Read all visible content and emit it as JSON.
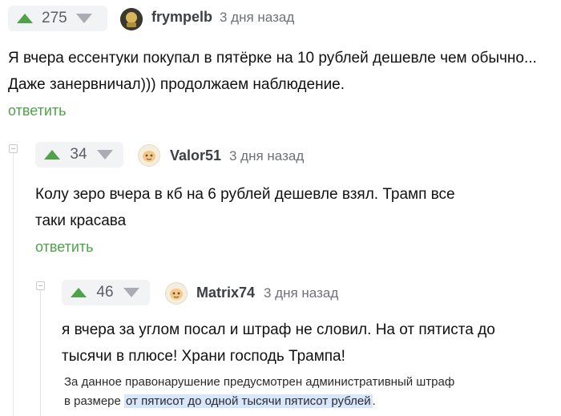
{
  "comments": [
    {
      "votes": "275",
      "user": "frympelb",
      "time": "3 дня назад",
      "lines": [
        "Я вчера ессентуки покупал в пятёрке на 10 рублей дешевле чем обычно...",
        "Даже занервничал))) продолжаем наблюдение."
      ],
      "reply": "ответить"
    },
    {
      "votes": "34",
      "user": "Valor51",
      "time": "3 дня назад",
      "lines": [
        "Колу зеро вчера в кб на 6 рублей дешевле взял. Трамп все",
        "таки красава"
      ],
      "reply": "ответить"
    },
    {
      "votes": "46",
      "user": "Matrix74",
      "time": "3 дня назад",
      "lines": [
        "я вчера за углом посал и штраф не словил. На от пятиста до",
        "тысячи в плюсе! Храни господь Трампа!"
      ],
      "quote": {
        "line1": "За данное правонарушение предусмотрен административный штраф",
        "line2_prefix": "в размере ",
        "line2_highlight": "от пятисот до одной тысячи пятисот рублей",
        "line2_suffix": "."
      }
    }
  ],
  "colors": {
    "accent": "#4fa24a",
    "vote_bg": "#f2f3f5",
    "highlight": "#d6e6fb"
  },
  "icons": [
    "arrow-up-icon",
    "arrow-down-icon",
    "avatar-icon",
    "collapse-icon"
  ]
}
